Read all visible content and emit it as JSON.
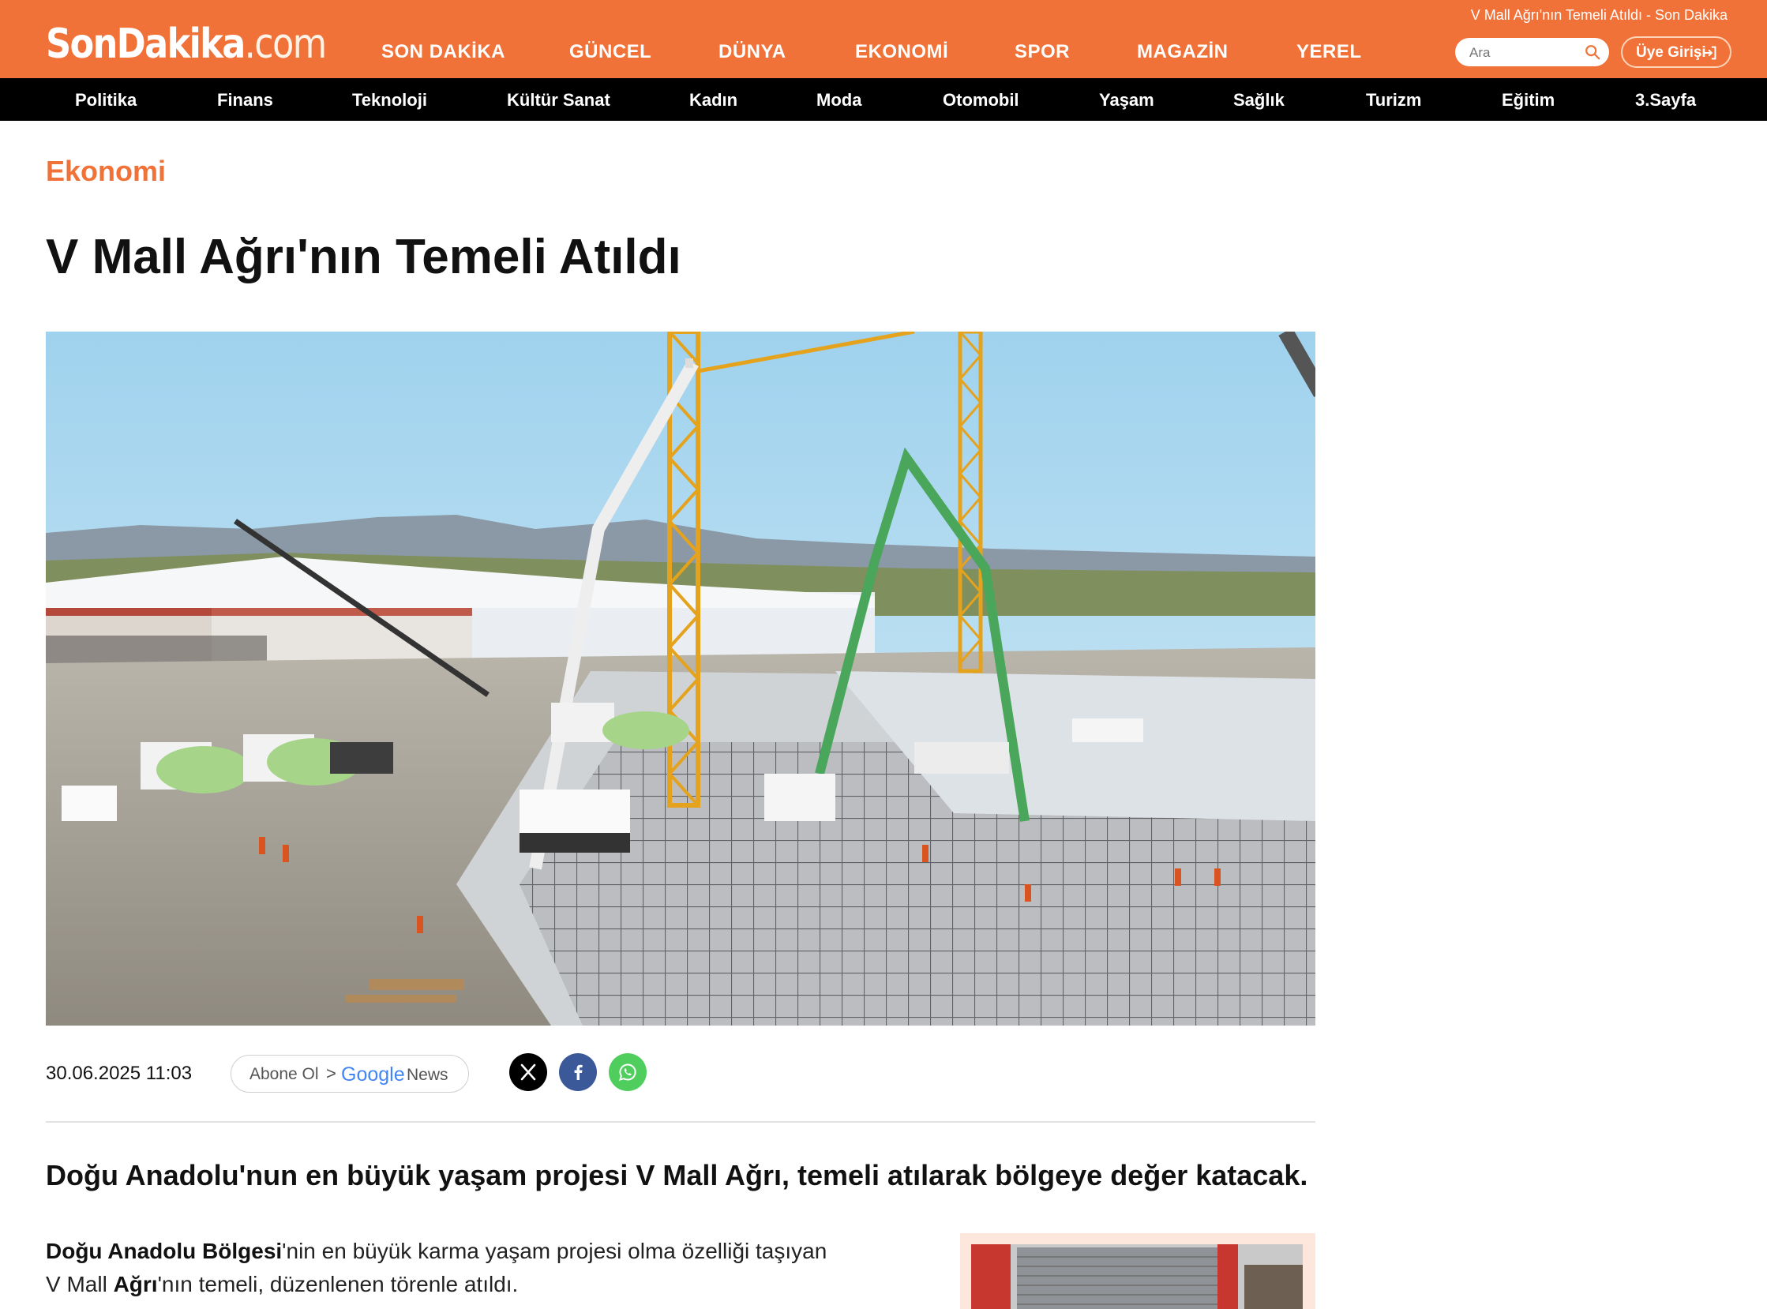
{
  "site": {
    "logo_main": "SonDakika",
    "logo_suffix": ".com",
    "top_title": "V Mall Ağrı'nın Temeli Atıldı - Son Dakika"
  },
  "main_nav": [
    "SON DAKİKA",
    "GÜNCEL",
    "DÜNYA",
    "EKONOMİ",
    "SPOR",
    "MAGAZİN",
    "YEREL"
  ],
  "search": {
    "placeholder": "Ara"
  },
  "login": {
    "label": "Üye Girişi"
  },
  "categories": [
    "Politika",
    "Finans",
    "Teknoloji",
    "Kültür Sanat",
    "Kadın",
    "Moda",
    "Otomobil",
    "Yaşam",
    "Sağlık",
    "Turizm",
    "Eğitim",
    "3.Sayfa"
  ],
  "article": {
    "section": "Ekonomi",
    "title": "V Mall Ağrı'nın Temeli Atıldı",
    "date": "30.06.2025 11:03",
    "google_news": {
      "abone": "Abone Ol",
      "chevron": ">",
      "google": "Google",
      "news": "News"
    },
    "lead": "Doğu Anadolu'nun en büyük yaşam projesi V Mall Ağrı, temeli atılarak bölgeye değer katacak.",
    "paragraph": {
      "bold1": "Doğu Anadolu Bölgesi",
      "text1": "'nin en büyük karma yaşam projesi olma özelliği taşıyan V Mall ",
      "bold2": "Ağrı",
      "text2": "'nın temeli, düzenlenen törenle atıldı."
    }
  },
  "icons": {
    "search": "search-icon",
    "login": "login-icon",
    "x": "x-twitter-icon",
    "facebook": "facebook-icon",
    "whatsapp": "whatsapp-icon"
  },
  "colors": {
    "brand": "#F07238",
    "catbar": "#000000",
    "facebook": "#3B5998",
    "whatsapp": "#4FCE5D"
  }
}
